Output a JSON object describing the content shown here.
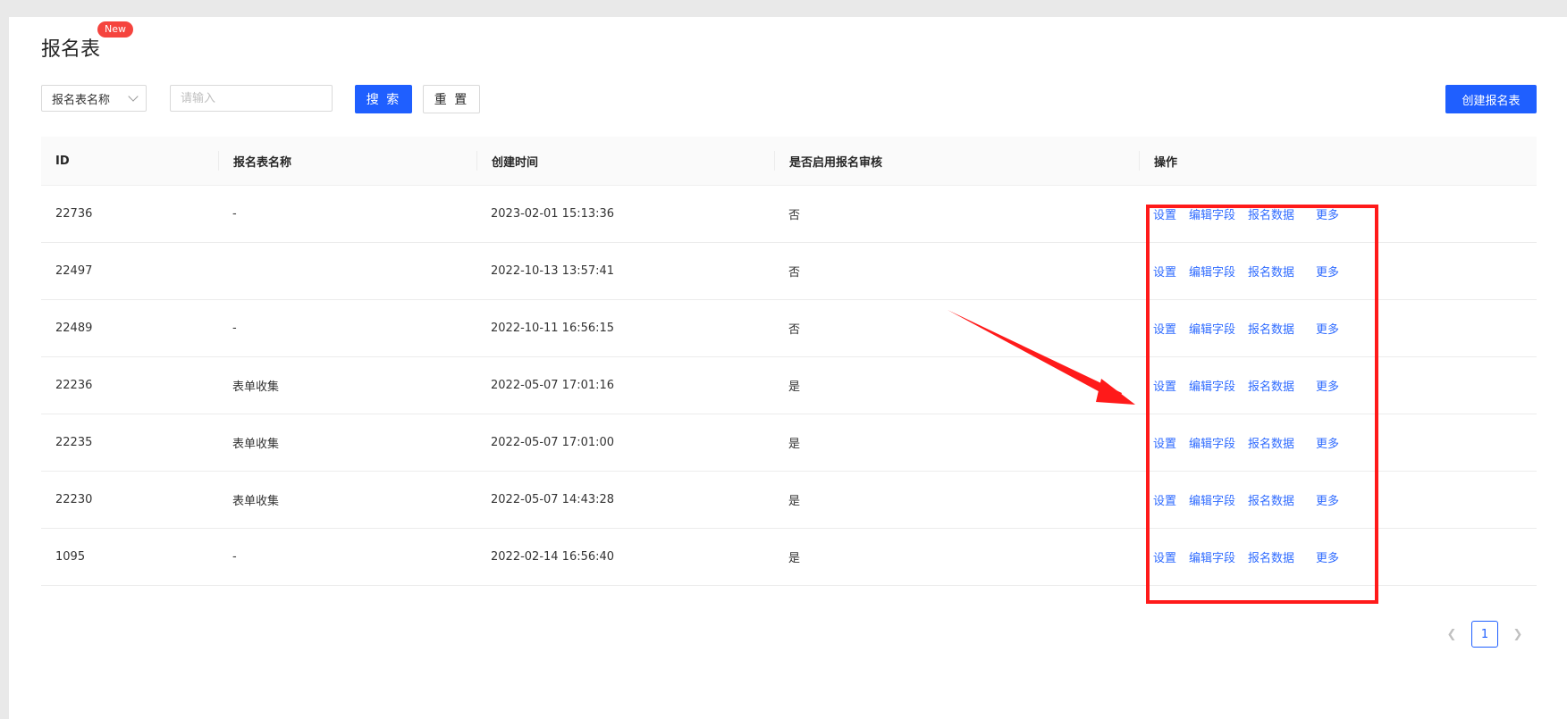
{
  "page": {
    "title": "报名表",
    "badge": "New"
  },
  "filter": {
    "select_value": "报名表名称",
    "input_placeholder": "请输入",
    "search_label": "搜 索",
    "reset_label": "重 置",
    "create_label": "创建报名表"
  },
  "table": {
    "headers": [
      "ID",
      "报名表名称",
      "创建时间",
      "是否启用报名审核",
      "操作"
    ],
    "actions": [
      "设置",
      "编辑字段",
      "报名数据",
      "更多"
    ],
    "rows": [
      {
        "id": "22736",
        "name": "-",
        "created": "2023-02-01 15:13:36",
        "review": "否"
      },
      {
        "id": "22497",
        "name": "",
        "created": "2022-10-13 13:57:41",
        "review": "否"
      },
      {
        "id": "22489",
        "name": "-",
        "created": "2022-10-11 16:56:15",
        "review": "否"
      },
      {
        "id": "22236",
        "name": "表单收集",
        "created": "2022-05-07 17:01:16",
        "review": "是"
      },
      {
        "id": "22235",
        "name": "表单收集",
        "created": "2022-05-07 17:01:00",
        "review": "是"
      },
      {
        "id": "22230",
        "name": "表单收集",
        "created": "2022-05-07 14:43:28",
        "review": "是"
      },
      {
        "id": "1095",
        "name": "-",
        "created": "2022-02-14 16:56:40",
        "review": "是"
      }
    ]
  },
  "pagination": {
    "current": "1",
    "prev_icon": "chevron-left-icon",
    "next_icon": "chevron-right-icon"
  },
  "colors": {
    "primary": "#1f5fff",
    "link": "#2f6bff",
    "badge": "#f5443e",
    "highlight": "#ff1a1a"
  }
}
